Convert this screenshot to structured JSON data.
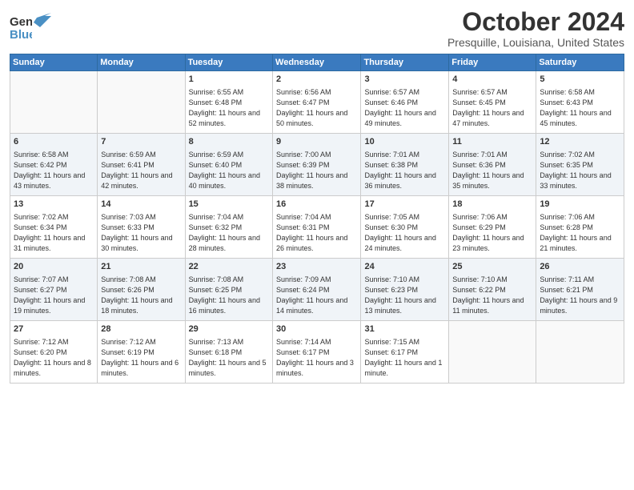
{
  "header": {
    "logo_line1": "General",
    "logo_line2": "Blue",
    "month": "October 2024",
    "location": "Presquille, Louisiana, United States"
  },
  "days_of_week": [
    "Sunday",
    "Monday",
    "Tuesday",
    "Wednesday",
    "Thursday",
    "Friday",
    "Saturday"
  ],
  "weeks": [
    [
      {
        "day": "",
        "info": ""
      },
      {
        "day": "",
        "info": ""
      },
      {
        "day": "1",
        "info": "Sunrise: 6:55 AM\nSunset: 6:48 PM\nDaylight: 11 hours and 52 minutes."
      },
      {
        "day": "2",
        "info": "Sunrise: 6:56 AM\nSunset: 6:47 PM\nDaylight: 11 hours and 50 minutes."
      },
      {
        "day": "3",
        "info": "Sunrise: 6:57 AM\nSunset: 6:46 PM\nDaylight: 11 hours and 49 minutes."
      },
      {
        "day": "4",
        "info": "Sunrise: 6:57 AM\nSunset: 6:45 PM\nDaylight: 11 hours and 47 minutes."
      },
      {
        "day": "5",
        "info": "Sunrise: 6:58 AM\nSunset: 6:43 PM\nDaylight: 11 hours and 45 minutes."
      }
    ],
    [
      {
        "day": "6",
        "info": "Sunrise: 6:58 AM\nSunset: 6:42 PM\nDaylight: 11 hours and 43 minutes."
      },
      {
        "day": "7",
        "info": "Sunrise: 6:59 AM\nSunset: 6:41 PM\nDaylight: 11 hours and 42 minutes."
      },
      {
        "day": "8",
        "info": "Sunrise: 6:59 AM\nSunset: 6:40 PM\nDaylight: 11 hours and 40 minutes."
      },
      {
        "day": "9",
        "info": "Sunrise: 7:00 AM\nSunset: 6:39 PM\nDaylight: 11 hours and 38 minutes."
      },
      {
        "day": "10",
        "info": "Sunrise: 7:01 AM\nSunset: 6:38 PM\nDaylight: 11 hours and 36 minutes."
      },
      {
        "day": "11",
        "info": "Sunrise: 7:01 AM\nSunset: 6:36 PM\nDaylight: 11 hours and 35 minutes."
      },
      {
        "day": "12",
        "info": "Sunrise: 7:02 AM\nSunset: 6:35 PM\nDaylight: 11 hours and 33 minutes."
      }
    ],
    [
      {
        "day": "13",
        "info": "Sunrise: 7:02 AM\nSunset: 6:34 PM\nDaylight: 11 hours and 31 minutes."
      },
      {
        "day": "14",
        "info": "Sunrise: 7:03 AM\nSunset: 6:33 PM\nDaylight: 11 hours and 30 minutes."
      },
      {
        "day": "15",
        "info": "Sunrise: 7:04 AM\nSunset: 6:32 PM\nDaylight: 11 hours and 28 minutes."
      },
      {
        "day": "16",
        "info": "Sunrise: 7:04 AM\nSunset: 6:31 PM\nDaylight: 11 hours and 26 minutes."
      },
      {
        "day": "17",
        "info": "Sunrise: 7:05 AM\nSunset: 6:30 PM\nDaylight: 11 hours and 24 minutes."
      },
      {
        "day": "18",
        "info": "Sunrise: 7:06 AM\nSunset: 6:29 PM\nDaylight: 11 hours and 23 minutes."
      },
      {
        "day": "19",
        "info": "Sunrise: 7:06 AM\nSunset: 6:28 PM\nDaylight: 11 hours and 21 minutes."
      }
    ],
    [
      {
        "day": "20",
        "info": "Sunrise: 7:07 AM\nSunset: 6:27 PM\nDaylight: 11 hours and 19 minutes."
      },
      {
        "day": "21",
        "info": "Sunrise: 7:08 AM\nSunset: 6:26 PM\nDaylight: 11 hours and 18 minutes."
      },
      {
        "day": "22",
        "info": "Sunrise: 7:08 AM\nSunset: 6:25 PM\nDaylight: 11 hours and 16 minutes."
      },
      {
        "day": "23",
        "info": "Sunrise: 7:09 AM\nSunset: 6:24 PM\nDaylight: 11 hours and 14 minutes."
      },
      {
        "day": "24",
        "info": "Sunrise: 7:10 AM\nSunset: 6:23 PM\nDaylight: 11 hours and 13 minutes."
      },
      {
        "day": "25",
        "info": "Sunrise: 7:10 AM\nSunset: 6:22 PM\nDaylight: 11 hours and 11 minutes."
      },
      {
        "day": "26",
        "info": "Sunrise: 7:11 AM\nSunset: 6:21 PM\nDaylight: 11 hours and 9 minutes."
      }
    ],
    [
      {
        "day": "27",
        "info": "Sunrise: 7:12 AM\nSunset: 6:20 PM\nDaylight: 11 hours and 8 minutes."
      },
      {
        "day": "28",
        "info": "Sunrise: 7:12 AM\nSunset: 6:19 PM\nDaylight: 11 hours and 6 minutes."
      },
      {
        "day": "29",
        "info": "Sunrise: 7:13 AM\nSunset: 6:18 PM\nDaylight: 11 hours and 5 minutes."
      },
      {
        "day": "30",
        "info": "Sunrise: 7:14 AM\nSunset: 6:17 PM\nDaylight: 11 hours and 3 minutes."
      },
      {
        "day": "31",
        "info": "Sunrise: 7:15 AM\nSunset: 6:17 PM\nDaylight: 11 hours and 1 minute."
      },
      {
        "day": "",
        "info": ""
      },
      {
        "day": "",
        "info": ""
      }
    ]
  ]
}
